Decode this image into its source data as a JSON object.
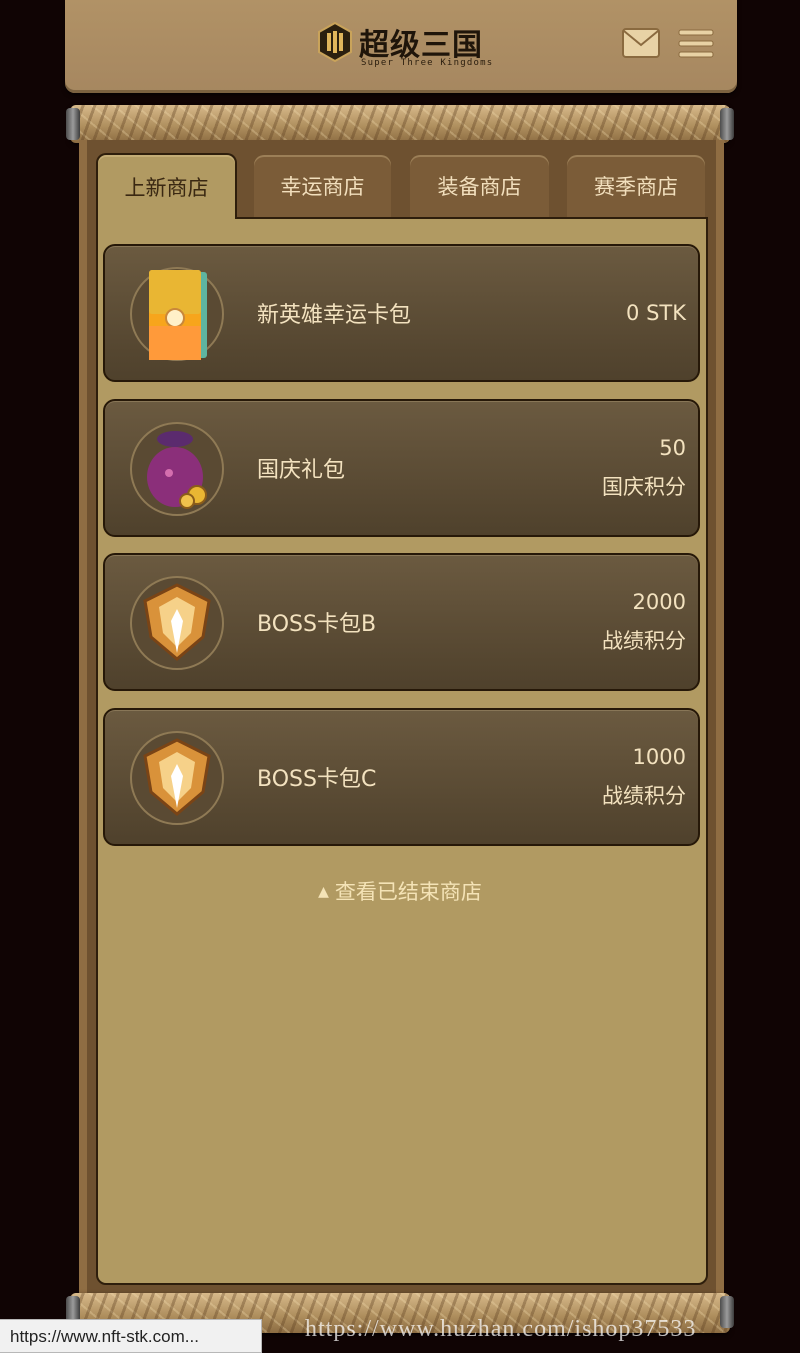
{
  "header": {
    "logo_title": "超级三国",
    "logo_subtitle": "Super Three Kingdoms"
  },
  "tabs": [
    {
      "label": "上新商店",
      "active": true
    },
    {
      "label": "幸运商店",
      "active": false
    },
    {
      "label": "装备商店",
      "active": false
    },
    {
      "label": "赛季商店",
      "active": false
    }
  ],
  "items": [
    {
      "name": "新英雄幸运卡包",
      "price": "0 STK",
      "currency": "",
      "icon": "orange-card-pack-icon"
    },
    {
      "name": "国庆礼包",
      "price": "50",
      "currency": "国庆积分",
      "icon": "purple-gift-bag-icon"
    },
    {
      "name": "BOSS卡包B",
      "price": "2000",
      "currency": "战绩积分",
      "icon": "golden-crest-icon"
    },
    {
      "name": "BOSS卡包C",
      "price": "1000",
      "currency": "战绩积分",
      "icon": "golden-crest-icon"
    }
  ],
  "ended_shops_link": "查看已结束商店",
  "status_url": "https://www.nft-stk.com...",
  "watermark": "https://www.huzhan.com/ishop37533",
  "colors": {
    "background": "#100404",
    "parchment": "#b19a62",
    "card": "#5c4c35",
    "text_light": "#f3e2bf"
  }
}
